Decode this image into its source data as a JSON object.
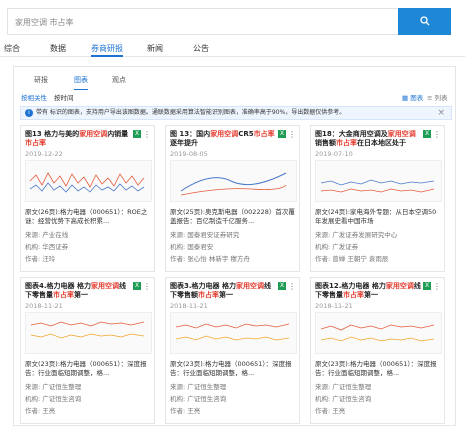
{
  "search": {
    "placeholder": "家用空调 市占率",
    "button_icon": "search-icon"
  },
  "tabs": [
    "综合",
    "数据",
    "券商研报",
    "新闻",
    "公告"
  ],
  "subtabs": [
    "研报",
    "图表",
    "观点"
  ],
  "filters": [
    "按相关性",
    "按时间"
  ],
  "view": {
    "grid": "图表",
    "list": "列表"
  },
  "notice": "带有 标识的图表，支持用户导出该图数据。通联数据采用算法智能识别图表，准确率高于90%，导出数据仅供参考。",
  "cards": [
    {
      "title_a": "图13 格力与美的",
      "title_hl": "家用空调",
      "title_b": "内销量",
      "title_hl2": "市占率",
      "date": "2019-12-22",
      "desc": "原文(26页):格力电器（000651）：ROE之谜：经营优势下高成长积累...",
      "source": "来源: 产业在线",
      "org": "机构: 华西证券",
      "author": "作者: 汪玲"
    },
    {
      "title_a": "图 13：国内",
      "title_hl": "家用空调",
      "title_b": "CR5",
      "title_hl2": "市占率",
      "title_c": "逐年提升",
      "date": "2019-08-05",
      "desc": "原文(25页):奥克斯电器（002228）首次覆盖报告：百亿制造千亿服务...",
      "source": "来源: 国泰君安证券研究",
      "org": "机构: 国泰君安",
      "author": "作者: 张心怡 林新宇 穆方舟"
    },
    {
      "title_a": "图18：大金商用空调及",
      "title_hl": "家用空调",
      "title_b": "销售额",
      "title_hl2": "市占率",
      "title_c": "在日本地区处于",
      "date": "2019-07-10",
      "desc": "原文(24页):家电海外专题：从日本空调50年发展史看中国市场",
      "source": "来源: 广发证券发展研究中心",
      "org": "机构: 广发证券",
      "author": "作者: 曾婵 王朝宁 袁雨辰"
    },
    {
      "title_a": "图表4.格力电器 格力",
      "title_hl": "家用空调",
      "title_b": "线下零售量",
      "title_hl2": "市占率",
      "title_c": "第一",
      "date": "2018-11-21",
      "desc": "原文(23页):格力电器（000651）：深度报告：行业面临短期调整，格...",
      "source": "来源: 广证恒生整理",
      "org": "机构: 广证恒生咨询",
      "author": "作者: 王亮"
    },
    {
      "title_a": "图表3.格力电器 格力",
      "title_hl": "家用空调",
      "title_b": "线下零售额",
      "title_hl2": "市占率",
      "title_c": "第一",
      "date": "2018-11-21",
      "desc": "原文(23页):格力电器（000651）：深度报告：行业面临短期调整，格...",
      "source": "来源: 广证恒生整理",
      "org": "机构: 广证恒生咨询",
      "author": "作者: 王亮"
    },
    {
      "title_a": "图表12.格力电器 格力",
      "title_hl": "家用空调",
      "title_b": "线下零售量",
      "title_hl2": "市占率",
      "title_c": "第一",
      "date": "2018-11-21",
      "desc": "原文(23页):格力电器（000651）：深度报告：行业面临短期调整，格...",
      "source": "来源: 广证恒生整理",
      "org": "机构: 广证恒生咨询",
      "author": "作者: 王亮"
    }
  ]
}
